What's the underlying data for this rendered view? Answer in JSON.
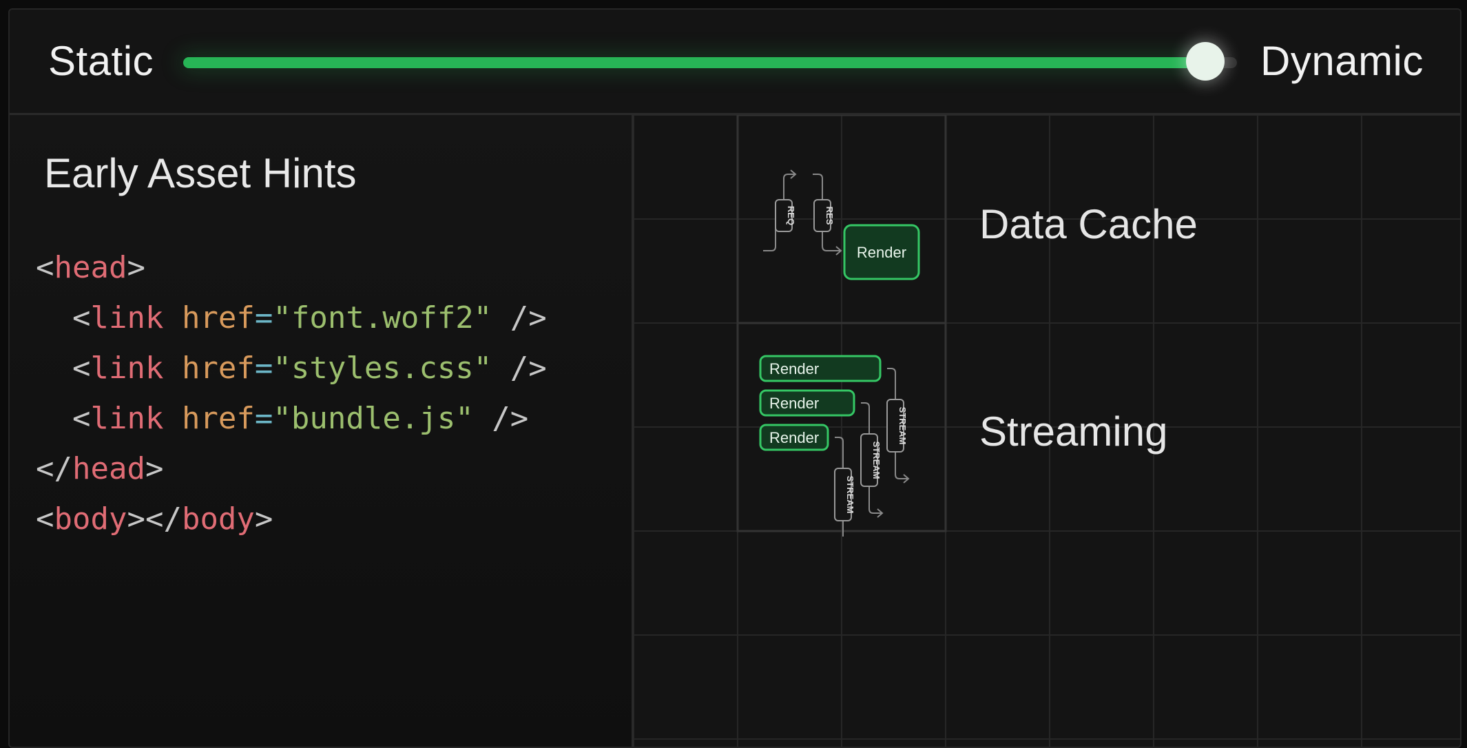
{
  "slider": {
    "left_label": "Static",
    "right_label": "Dynamic",
    "value": 0.97,
    "accent_color": "#27b556"
  },
  "code_panel": {
    "title": "Early Asset Hints",
    "lines": [
      [
        {
          "k": "p",
          "v": "<"
        },
        {
          "k": "t",
          "v": "head"
        },
        {
          "k": "p",
          "v": ">"
        }
      ],
      [
        {
          "k": "p",
          "v": "  <"
        },
        {
          "k": "t",
          "v": "link "
        },
        {
          "k": "a",
          "v": "href"
        },
        {
          "k": "e",
          "v": "="
        },
        {
          "k": "s",
          "v": "\"font.woff2\""
        },
        {
          "k": "p",
          "v": " />"
        }
      ],
      [
        {
          "k": "p",
          "v": "  <"
        },
        {
          "k": "t",
          "v": "link "
        },
        {
          "k": "a",
          "v": "href"
        },
        {
          "k": "e",
          "v": "="
        },
        {
          "k": "s",
          "v": "\"styles.css\""
        },
        {
          "k": "p",
          "v": " />"
        }
      ],
      [
        {
          "k": "p",
          "v": "  <"
        },
        {
          "k": "t",
          "v": "link "
        },
        {
          "k": "a",
          "v": "href"
        },
        {
          "k": "e",
          "v": "="
        },
        {
          "k": "s",
          "v": "\"bundle.js\""
        },
        {
          "k": "p",
          "v": " />"
        }
      ],
      [
        {
          "k": "p",
          "v": "</"
        },
        {
          "k": "t",
          "v": "head"
        },
        {
          "k": "p",
          "v": ">"
        }
      ],
      [
        {
          "k": "p",
          "v": "<"
        },
        {
          "k": "t",
          "v": "body"
        },
        {
          "k": "p",
          "v": "></"
        },
        {
          "k": "t",
          "v": "body"
        },
        {
          "k": "p",
          "v": ">"
        }
      ]
    ]
  },
  "features": {
    "data_cache": {
      "label": "Data Cache",
      "req_label": "REQ",
      "res_label": "RES",
      "render_label": "Render"
    },
    "streaming": {
      "label": "Streaming",
      "render_labels": [
        "Render",
        "Render",
        "Render"
      ],
      "stream_labels": [
        "STREAM",
        "STREAM",
        "STREAM"
      ]
    }
  }
}
